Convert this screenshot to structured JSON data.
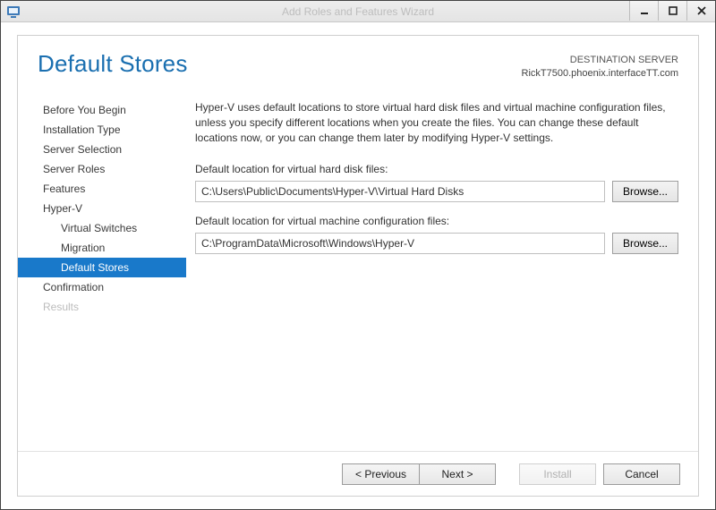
{
  "window": {
    "title": "Add Roles and Features Wizard"
  },
  "header": {
    "page_title": "Default Stores",
    "dest_label": "DESTINATION SERVER",
    "dest_server": "RickT7500.phoenix.interfaceTT.com"
  },
  "sidebar": {
    "items": [
      {
        "label": "Before You Begin"
      },
      {
        "label": "Installation Type"
      },
      {
        "label": "Server Selection"
      },
      {
        "label": "Server Roles"
      },
      {
        "label": "Features"
      },
      {
        "label": "Hyper-V"
      },
      {
        "label": "Virtual Switches",
        "sub": true
      },
      {
        "label": "Migration",
        "sub": true
      },
      {
        "label": "Default Stores",
        "sub": true,
        "selected": true
      },
      {
        "label": "Confirmation"
      },
      {
        "label": "Results",
        "disabled": true
      }
    ]
  },
  "main": {
    "intro": "Hyper-V uses default locations to store virtual hard disk files and virtual machine configuration files, unless you specify different locations when you create the files. You can change these default locations now, or you can change them later by modifying Hyper-V settings.",
    "vhd_label": "Default location for virtual hard disk files:",
    "vhd_path": "C:\\Users\\Public\\Documents\\Hyper-V\\Virtual Hard Disks",
    "cfg_label": "Default location for virtual machine configuration files:",
    "cfg_path": "C:\\ProgramData\\Microsoft\\Windows\\Hyper-V",
    "browse_label": "Browse..."
  },
  "footer": {
    "previous": "< Previous",
    "next": "Next >",
    "install": "Install",
    "cancel": "Cancel"
  }
}
